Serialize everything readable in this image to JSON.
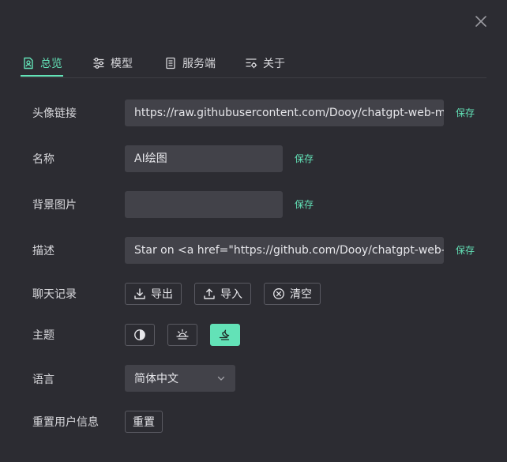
{
  "tabs": [
    {
      "label": "总览",
      "icon": "profile-icon"
    },
    {
      "label": "模型",
      "icon": "sliders-icon"
    },
    {
      "label": "服务端",
      "icon": "server-icon"
    },
    {
      "label": "关于",
      "icon": "settings-list-icon"
    }
  ],
  "fields": {
    "avatar": {
      "label": "头像链接",
      "value": "https://raw.githubusercontent.com/Dooy/chatgpt-web-m",
      "save": "保存"
    },
    "name": {
      "label": "名称",
      "value": "AI绘图",
      "save": "保存"
    },
    "background": {
      "label": "背景图片",
      "value": "",
      "save": "保存"
    },
    "description": {
      "label": "描述",
      "value": "Star on <a href=\"https://github.com/Dooy/chatgpt-web-",
      "save": "保存"
    }
  },
  "chat_history": {
    "label": "聊天记录",
    "export": "导出",
    "import": "导入",
    "clear": "清空"
  },
  "theme": {
    "label": "主题",
    "options": [
      "auto-theme-icon",
      "light-theme-icon",
      "dark-theme-icon"
    ],
    "selected": "dark"
  },
  "language": {
    "label": "语言",
    "value": "简体中文"
  },
  "reset": {
    "label": "重置用户信息",
    "button": "重置"
  },
  "colors": {
    "accent": "#63e2b7",
    "background": "#2c2c32",
    "input": "#424249"
  }
}
